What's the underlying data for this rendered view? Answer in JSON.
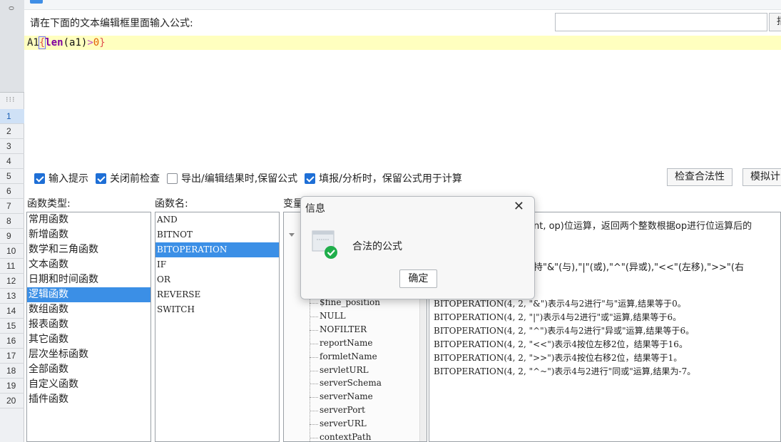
{
  "rows": [
    "1",
    "2",
    "3",
    "4",
    "5",
    "6",
    "7",
    "8",
    "9",
    "10",
    "11",
    "12",
    "13",
    "14",
    "15",
    "16",
    "17",
    "18",
    "19",
    "20"
  ],
  "rowbar_top": "0",
  "prompt": "请在下面的文本编辑框里面输入公式:",
  "edge_button": "指",
  "formula": {
    "cell": "A1",
    "brace_open": "{",
    "fn": "len",
    "paren_open": "(",
    "arg": "a1",
    "paren_close": ")",
    "op": ">",
    "num": "0",
    "brace_close": "}"
  },
  "options": [
    {
      "label": "输入提示",
      "checked": true
    },
    {
      "label": "关闭前检查",
      "checked": true
    },
    {
      "label": "导出/编辑结果时,保留公式",
      "checked": false
    },
    {
      "label": "填报/分析时，保留公式用于计算",
      "checked": true
    }
  ],
  "buttons": {
    "check": "检查合法性",
    "simulate": "模拟计"
  },
  "labels": {
    "fn_type": "函数类型:",
    "fn_name": "函数名:",
    "var": "变量"
  },
  "fn_types": [
    "常用函数",
    "新增函数",
    "数学和三角函数",
    "文本函数",
    "日期和时间函数",
    "逻辑函数",
    "数组函数",
    "报表函数",
    "其它函数",
    "层次坐标函数",
    "全部函数",
    "自定义函数",
    "插件函数"
  ],
  "fn_type_selected": 5,
  "fn_names": [
    "AND",
    "BITNOT",
    "BITOPERATION",
    "IF",
    "OR",
    "REVERSE",
    "SWITCH"
  ],
  "fn_name_selected": 2,
  "vars": [
    "$fine_position",
    "NULL",
    "NOFILTER",
    "reportName",
    "formletName",
    "servletURL",
    "serverSchema",
    "serverName",
    "serverPort",
    "serverURL",
    "contextPath"
  ],
  "desc": {
    "line1": "nt, op)位运算，返回两个整数根据op进行位运算后的",
    "line2": "持\"&\"(与),\"|\"(或),\"^\"(异或),\"<<\"(左移),\">>\"(右",
    "examples": [
      "BITOPERATION(4, 2, \"&\")表示4与2进行\"与\"运算,结果等于0。",
      "BITOPERATION(4, 2, \"|\")表示4与2进行\"或\"运算,结果等于6。",
      "BITOPERATION(4, 2, \"^\")表示4与2进行\"异或\"运算,结果等于6。",
      "BITOPERATION(4, 2, \"<<\")表示4按位左移2位，结果等于16。",
      "BITOPERATION(4, 2, \">>\")表示4按位右移2位，结果等于1。",
      "BITOPERATION(4, 2, \"^~\")表示4与2进行\"同或\"运算,结果为-7。"
    ]
  },
  "dialog": {
    "title": "信息",
    "message": "合法的公式",
    "ok": "确定",
    "close": "✕"
  },
  "colors": {
    "accent": "#1e6fd6",
    "selection": "#3b8fe6",
    "editor_line": "#ffffbf",
    "success": "#1fae4b"
  }
}
